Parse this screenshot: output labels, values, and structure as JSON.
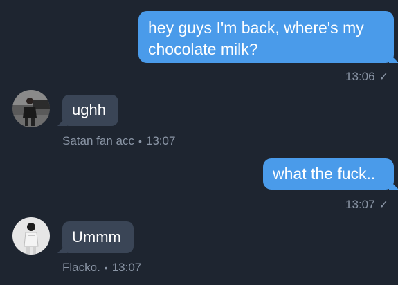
{
  "messages": [
    {
      "text_line1": "hey guys I'm back, where's my",
      "text_line2": "chocolate milk?",
      "time": "13:06",
      "status": "✓"
    },
    {
      "text": "ughh",
      "sender": "Satan fan acc",
      "separator": "•",
      "time": "13:07"
    },
    {
      "text": "what the fuck..",
      "time": "13:07",
      "status": "✓"
    },
    {
      "text": "Ummm",
      "sender": "Flacko.",
      "separator": "•",
      "time": "13:07"
    }
  ],
  "colors": {
    "background": "#1e2530",
    "outgoing_bubble": "#4a9bea",
    "incoming_bubble": "#3a4556",
    "meta_text": "#8a95a5"
  },
  "icons": {
    "read_status": "checkmark-icon",
    "avatar_1": "user-avatar-dark",
    "avatar_2": "user-avatar-light"
  }
}
